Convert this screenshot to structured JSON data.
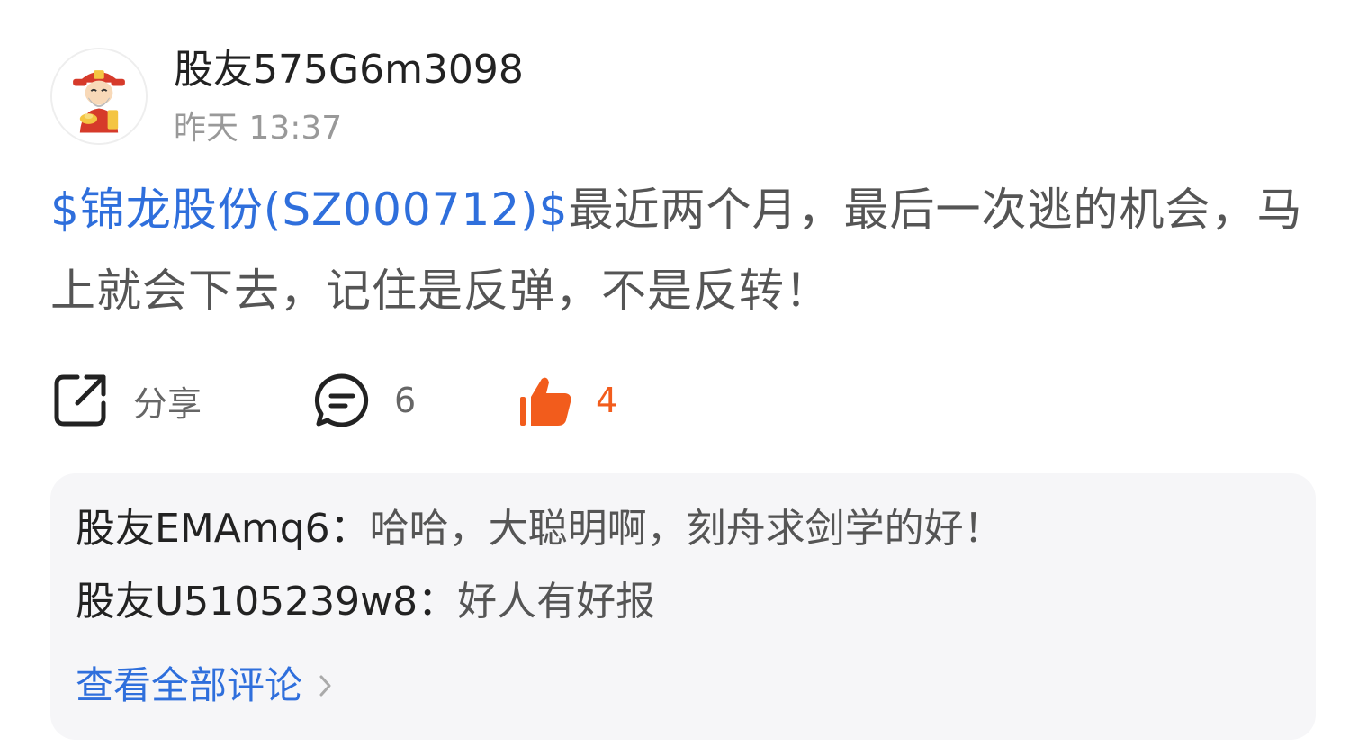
{
  "post": {
    "username": "股友575G6m3098",
    "timestamp": "昨天 13:37",
    "stock_tag": "$锦龙股份(SZ000712)$",
    "body": "最近两个月，最后一次逃的机会，马上就会下去，记住是反弹，不是反转！"
  },
  "actions": {
    "share_label": "分享",
    "comment_count": "6",
    "like_count": "4"
  },
  "comments": [
    {
      "author": "股友EMAmq6",
      "separator": "：",
      "text": "哈哈，大聪明啊，刻舟求剑学的好！"
    },
    {
      "author": "股友U5105239w8",
      "separator": "：",
      "text": "好人有好报"
    }
  ],
  "view_all_label": "查看全部评论",
  "icons": {
    "share": "share-icon",
    "comment": "comment-bubble-icon",
    "like": "thumbs-up-icon",
    "chevron": "chevron-right-icon",
    "avatar": "avatar-mascot"
  },
  "colors": {
    "link_blue": "#2f6fdc",
    "like_orange": "#f25c1c",
    "comments_bg": "#f6f6f8"
  }
}
